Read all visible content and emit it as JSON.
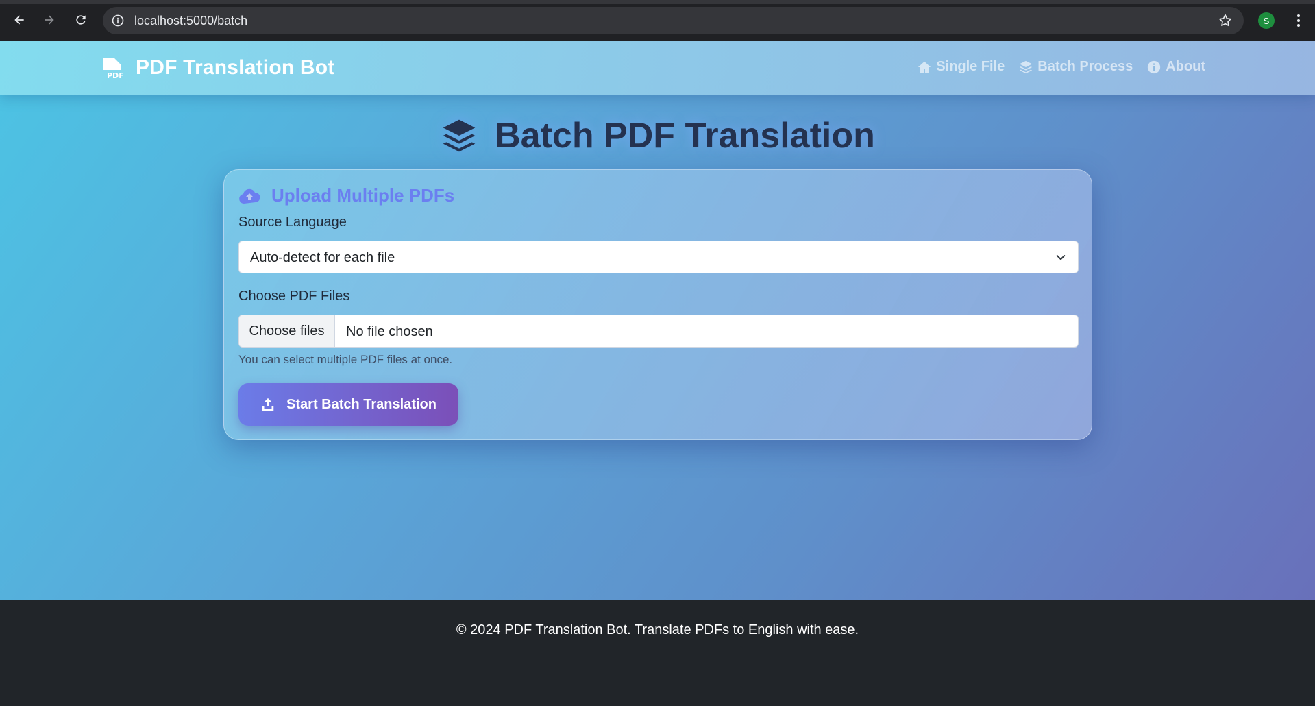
{
  "browser": {
    "url": "localhost:5000/batch",
    "profile_initial": "S"
  },
  "navbar": {
    "brand": "PDF Translation Bot",
    "links": [
      {
        "label": "Single File",
        "icon": "home-icon"
      },
      {
        "label": "Batch Process",
        "icon": "layers-icon"
      },
      {
        "label": "About",
        "icon": "info-icon"
      }
    ]
  },
  "page": {
    "title": "Batch PDF Translation",
    "title_icon": "layers-icon"
  },
  "card": {
    "title": "Upload Multiple PDFs",
    "title_icon": "cloud-upload-icon",
    "source_language_label": "Source Language",
    "source_language_value": "Auto-detect for each file",
    "files_label": "Choose PDF Files",
    "choose_files_button": "Choose files",
    "file_status": "No file chosen",
    "help_text": "You can select multiple PDF files at once.",
    "submit_label": "Start Batch Translation",
    "submit_icon": "upload-icon"
  },
  "footer": {
    "text": "© 2024 PDF Translation Bot. Translate PDFs to English with ease."
  },
  "colors": {
    "accent": "#6b7ff0",
    "button_start": "#6b7ce8",
    "button_end": "#7b4fb8",
    "footer_bg": "#212529",
    "title": "#243250"
  }
}
